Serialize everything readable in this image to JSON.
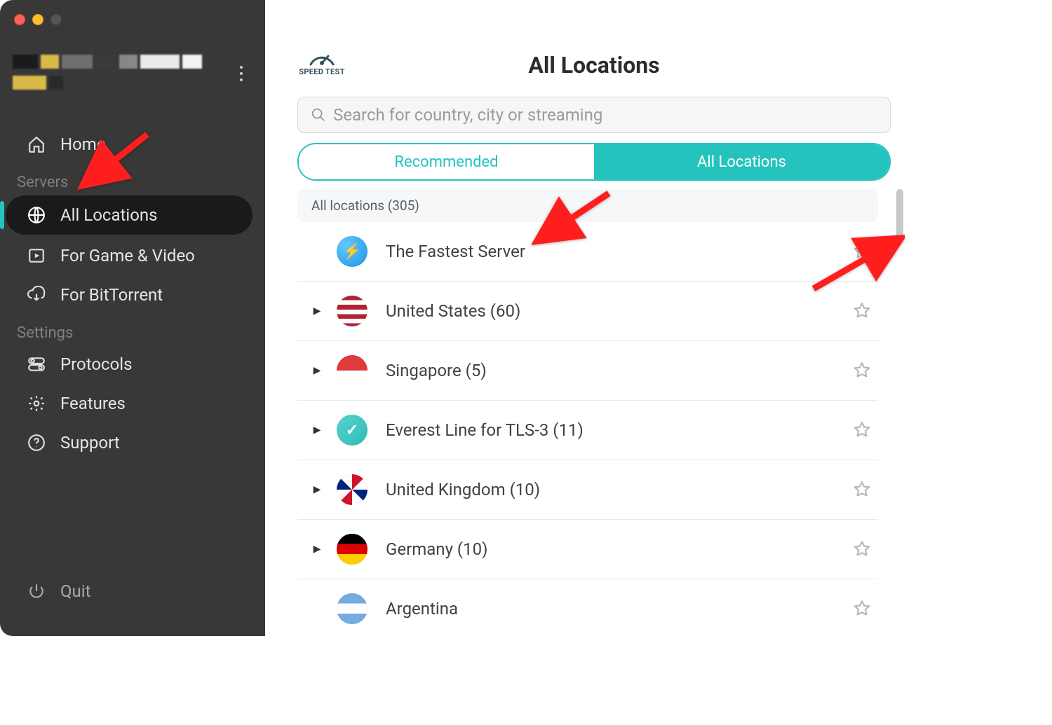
{
  "sidebar": {
    "home": "Home",
    "section_servers": "Servers",
    "all_locations": "All Locations",
    "game_video": "For Game & Video",
    "bittorrent": "For BitTorrent",
    "section_settings": "Settings",
    "protocols": "Protocols",
    "features": "Features",
    "support": "Support",
    "quit": "Quit"
  },
  "header": {
    "title": "All Locations",
    "speedtest": "SPEED TEST",
    "search_placeholder": "Search for country, city or streaming"
  },
  "tabs": {
    "recommended": "Recommended",
    "all": "All Locations"
  },
  "list": {
    "header": "All locations (305)",
    "rows": [
      {
        "name": "The Fastest Server",
        "flag": "fastest",
        "expandable": false
      },
      {
        "name": "United States (60)",
        "flag": "us",
        "expandable": true
      },
      {
        "name": "Singapore (5)",
        "flag": "sg",
        "expandable": true
      },
      {
        "name": "Everest Line for TLS-3 (11)",
        "flag": "ev",
        "expandable": true
      },
      {
        "name": "United Kingdom (10)",
        "flag": "uk",
        "expandable": true
      },
      {
        "name": "Germany (10)",
        "flag": "de",
        "expandable": true
      },
      {
        "name": "Argentina",
        "flag": "ar",
        "expandable": false
      }
    ]
  }
}
